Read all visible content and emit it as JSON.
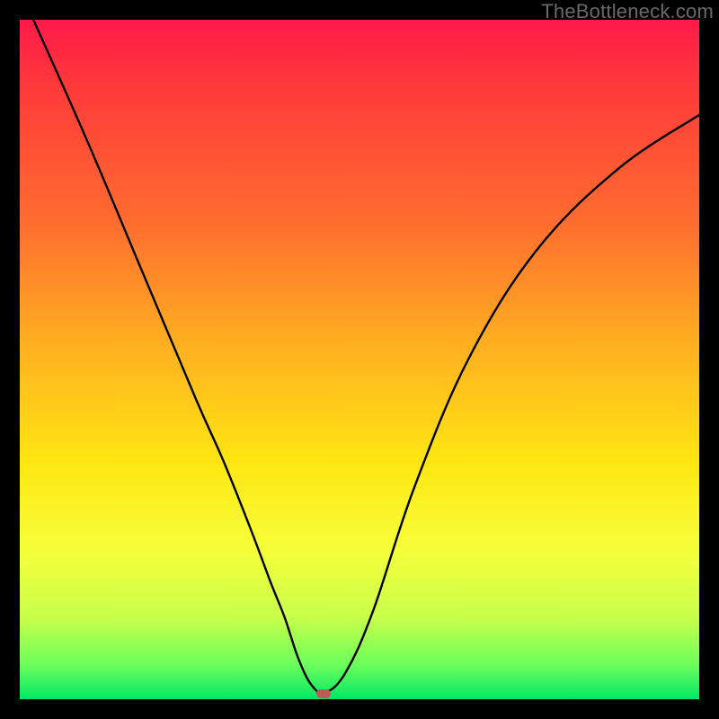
{
  "watermark": "TheBottleneck.com",
  "colors": {
    "frame": "#000000",
    "curve": "#000000",
    "marker": "#b85c54",
    "gradient_stops": [
      "#ff1a4a",
      "#ff3a3a",
      "#ff6d2f",
      "#ffb020",
      "#ffe612",
      "#f6ff3a",
      "#c8ff4a",
      "#6bff5c",
      "#00e865"
    ]
  },
  "chart_data": {
    "type": "line",
    "title": "",
    "xlabel": "",
    "ylabel": "",
    "xlim": [
      0,
      100
    ],
    "ylim": [
      0,
      100
    ],
    "grid": false,
    "legend": false,
    "note": "Axes are unlabeled; x spans plot width 0–100, y spans plot height 0–100 (0 at bottom). Values estimated from pixel positions on the rendered curve.",
    "x": [
      2,
      10,
      18,
      26,
      30,
      34,
      37,
      39,
      41,
      43,
      45,
      48,
      52,
      58,
      66,
      76,
      88,
      100
    ],
    "y": [
      100,
      82,
      63,
      44,
      35,
      25,
      17,
      12,
      6,
      2,
      1,
      4,
      13,
      31,
      50,
      66,
      78,
      86
    ],
    "min_marker": {
      "x_pct": 44.7,
      "y_pct": 0.8
    }
  }
}
